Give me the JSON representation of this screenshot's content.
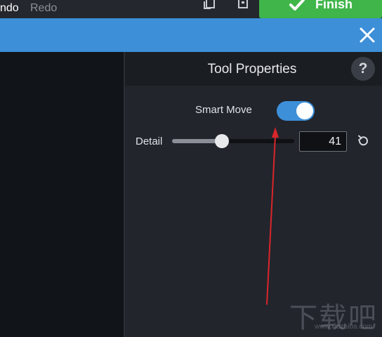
{
  "toolbar": {
    "undo_label": "ndo",
    "redo_label": "Redo",
    "finish_label": "Finish"
  },
  "panel": {
    "title": "Tool Properties",
    "help_label": "?",
    "smart_move": {
      "label": "Smart Move",
      "enabled": true
    },
    "detail": {
      "label": "Detail",
      "value": "41",
      "slider_fraction": 0.41
    }
  },
  "watermark": {
    "text": "下载吧",
    "url": "www.xiazaiba.com"
  },
  "colors": {
    "accent_blue": "#3d8fd8",
    "finish_green": "#3fb54a",
    "annotation_red": "#d8262a"
  },
  "icons": {
    "copy": "copy-icon",
    "paste": "paste-icon",
    "check": "check-icon",
    "close": "close-icon",
    "reset": "reset-icon"
  }
}
